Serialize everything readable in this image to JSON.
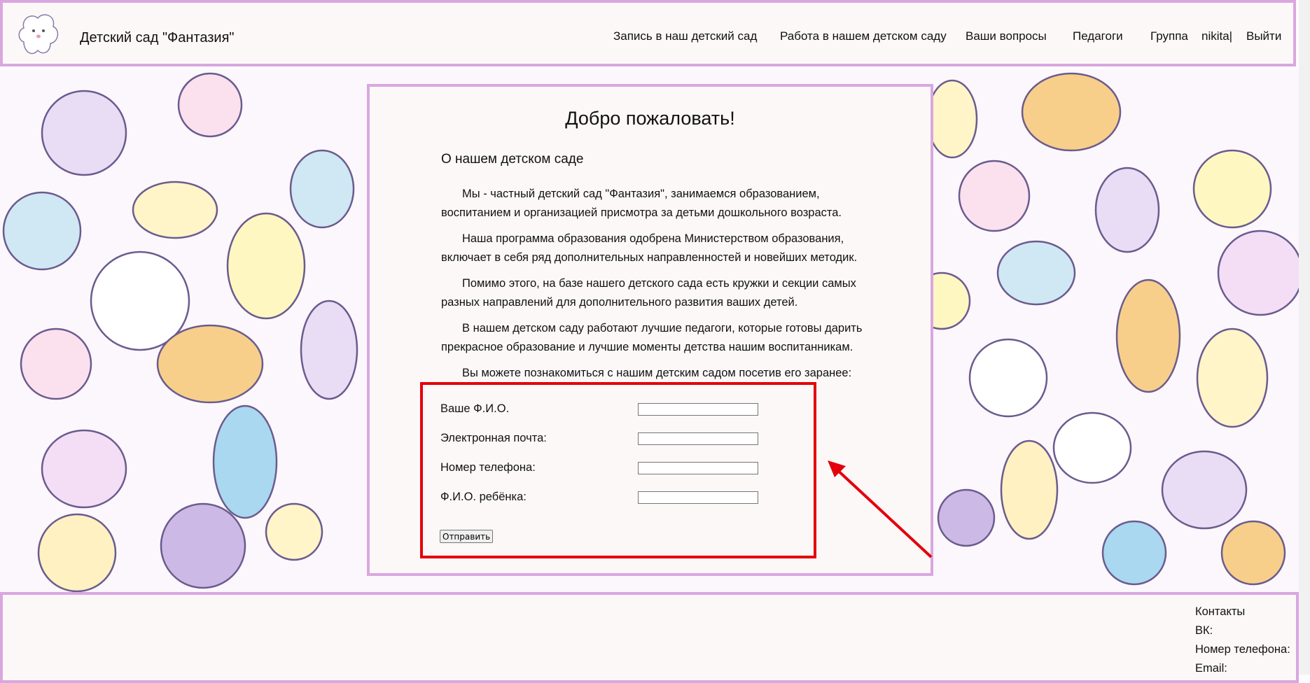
{
  "header": {
    "site_title": "Детский сад \"Фантазия\"",
    "nav": [
      "Запись в наш детский сад",
      "Работа в нашем детском саду",
      "Ваши вопросы",
      "Педагоги",
      "Группа"
    ],
    "username": "nikita|",
    "logout": "Выйти"
  },
  "main": {
    "welcome": "Добро пожаловать!",
    "about_title": "О нашем детском саде",
    "paragraphs": [
      "Мы - частный детский сад \"Фантазия\", занимаемся образованием, воспитанием и организацией присмотра за детьми дошкольного возраста.",
      "Наша программа образования одобрена Министерством образования, включает в себя ряд дополнительных направленностей и новейших методик.",
      "Помимо этого, на базе нашего детского сада есть кружки и секции самых разных направлений для дополнительного развития ваших детей.",
      "В нашем детском саду работают лучшие педагоги, которые готовы дарить прекрасное образование и лучшие моменты детства нашим воспитанникам.",
      "Вы можете познакомиться с нашим детским садом посетив его заранее:"
    ]
  },
  "form": {
    "fio_label": "Ваше Ф.И.О.",
    "fio_value": "",
    "email_label": "Электронная почта:",
    "email_value": "",
    "phone_label": "Номер телефона:",
    "phone_value": "",
    "child_label": "Ф.И.О. ребёнка:",
    "child_value": "",
    "submit_label": "Отправить"
  },
  "footer": {
    "contacts_title": "Контакты",
    "vk": "ВК:",
    "phone": "Номер телефона:",
    "email": "Email:"
  },
  "colors": {
    "frame": "#d9a7e0",
    "panel": "#fdf8f8",
    "highlight": "#e3000b"
  }
}
